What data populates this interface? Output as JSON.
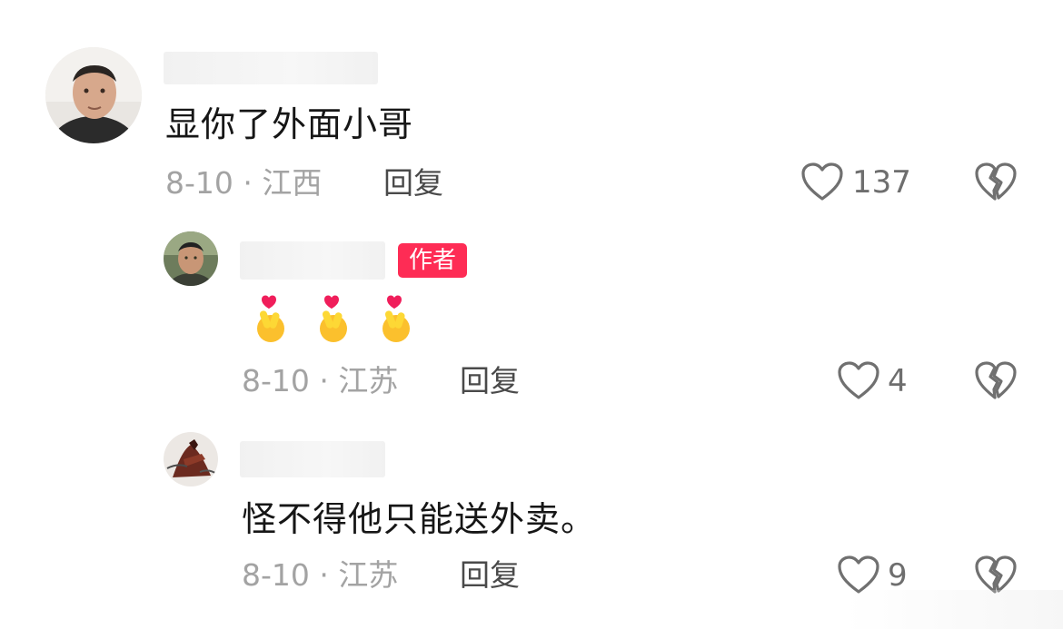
{
  "comments": [
    {
      "text": "显你了外面小哥",
      "meta": "8-10 · 江西",
      "reply_label": "回复",
      "likes": "137",
      "is_author": false
    },
    {
      "badge": "作者",
      "emoji_text": "🫰🫰🫰",
      "meta": "8-10 · 江苏",
      "reply_label": "回复",
      "likes": "4",
      "is_author": true
    },
    {
      "text": "怪不得他只能送外卖。",
      "meta": "8-10 · 江苏",
      "reply_label": "回复",
      "likes": "9",
      "is_author": false
    }
  ],
  "icons": {
    "like": "heart-outline-icon",
    "dislike": "broken-heart-icon"
  },
  "colors": {
    "badge": "#fe2c55",
    "meta": "#a3a3a3",
    "text": "#161616"
  }
}
